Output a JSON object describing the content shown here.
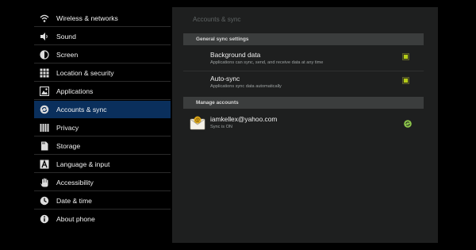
{
  "sidebar": {
    "items": [
      {
        "label": "Wireless & networks",
        "icon": "wifi-icon"
      },
      {
        "label": "Sound",
        "icon": "speaker-icon"
      },
      {
        "label": "Screen",
        "icon": "brightness-icon"
      },
      {
        "label": "Location & security",
        "icon": "grid-icon"
      },
      {
        "label": "Applications",
        "icon": "applications-icon"
      },
      {
        "label": "Accounts & sync",
        "icon": "sync-icon",
        "active": true
      },
      {
        "label": "Privacy",
        "icon": "privacy-icon"
      },
      {
        "label": "Storage",
        "icon": "storage-icon"
      },
      {
        "label": "Language & input",
        "icon": "language-icon"
      },
      {
        "label": "Accessibility",
        "icon": "hand-icon"
      },
      {
        "label": "Date & time",
        "icon": "clock-icon"
      },
      {
        "label": "About phone",
        "icon": "info-icon"
      }
    ]
  },
  "main": {
    "title": "Accounts & sync",
    "general_header": "General sync settings",
    "background_data": {
      "title": "Background data",
      "subtitle": "Applications can sync, send, and receive data at any time",
      "checked": true
    },
    "auto_sync": {
      "title": "Auto-sync",
      "subtitle": "Applications sync data automatically",
      "checked": true
    },
    "manage_header": "Manage accounts",
    "account": {
      "email": "iamkellex@yahoo.com",
      "status": "Sync is ON",
      "icon": "email-account-icon"
    }
  },
  "colors": {
    "active_item": "#0a2f5c",
    "checkbox_tick": "#b5cc18",
    "sync_green": "#8bc34a"
  }
}
